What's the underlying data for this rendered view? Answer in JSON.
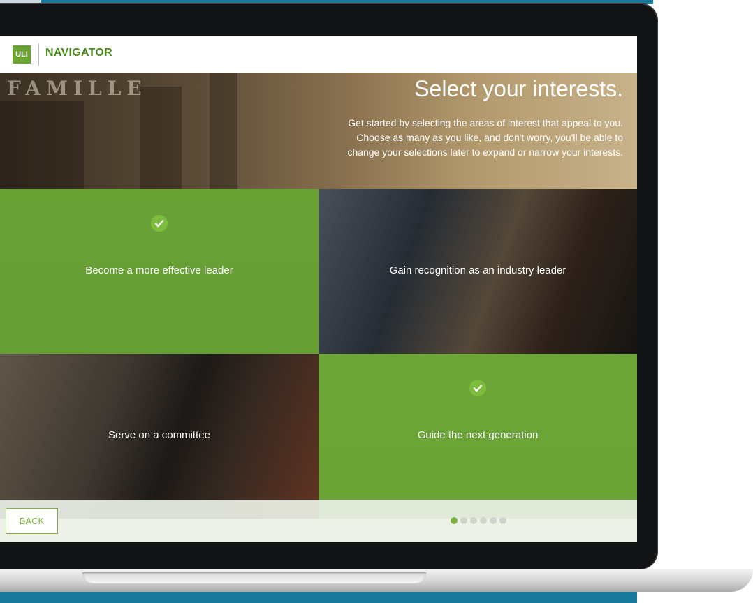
{
  "app": {
    "logo_text": "ULI",
    "name": "NAVIGATOR"
  },
  "hero": {
    "sign_text": "FAMILLE",
    "title": "Select your interests.",
    "description": "Get started by selecting the areas of interest that appeal to you. Choose as many as you like, and don't worry, you'll be able to change your selections later to expand or narrow your interests."
  },
  "tiles": [
    {
      "label": "Become a more effective leader",
      "selected": true
    },
    {
      "label": "Gain recognition as an industry leader",
      "selected": false
    },
    {
      "label": "Serve on a committee",
      "selected": false
    },
    {
      "label": "Guide the next generation",
      "selected": true
    }
  ],
  "footer": {
    "back_label": "BACK",
    "pagination": {
      "total": 6,
      "current": 1
    }
  },
  "colors": {
    "accent": "#7cb342",
    "frame_blue": "#1a7a9b"
  }
}
